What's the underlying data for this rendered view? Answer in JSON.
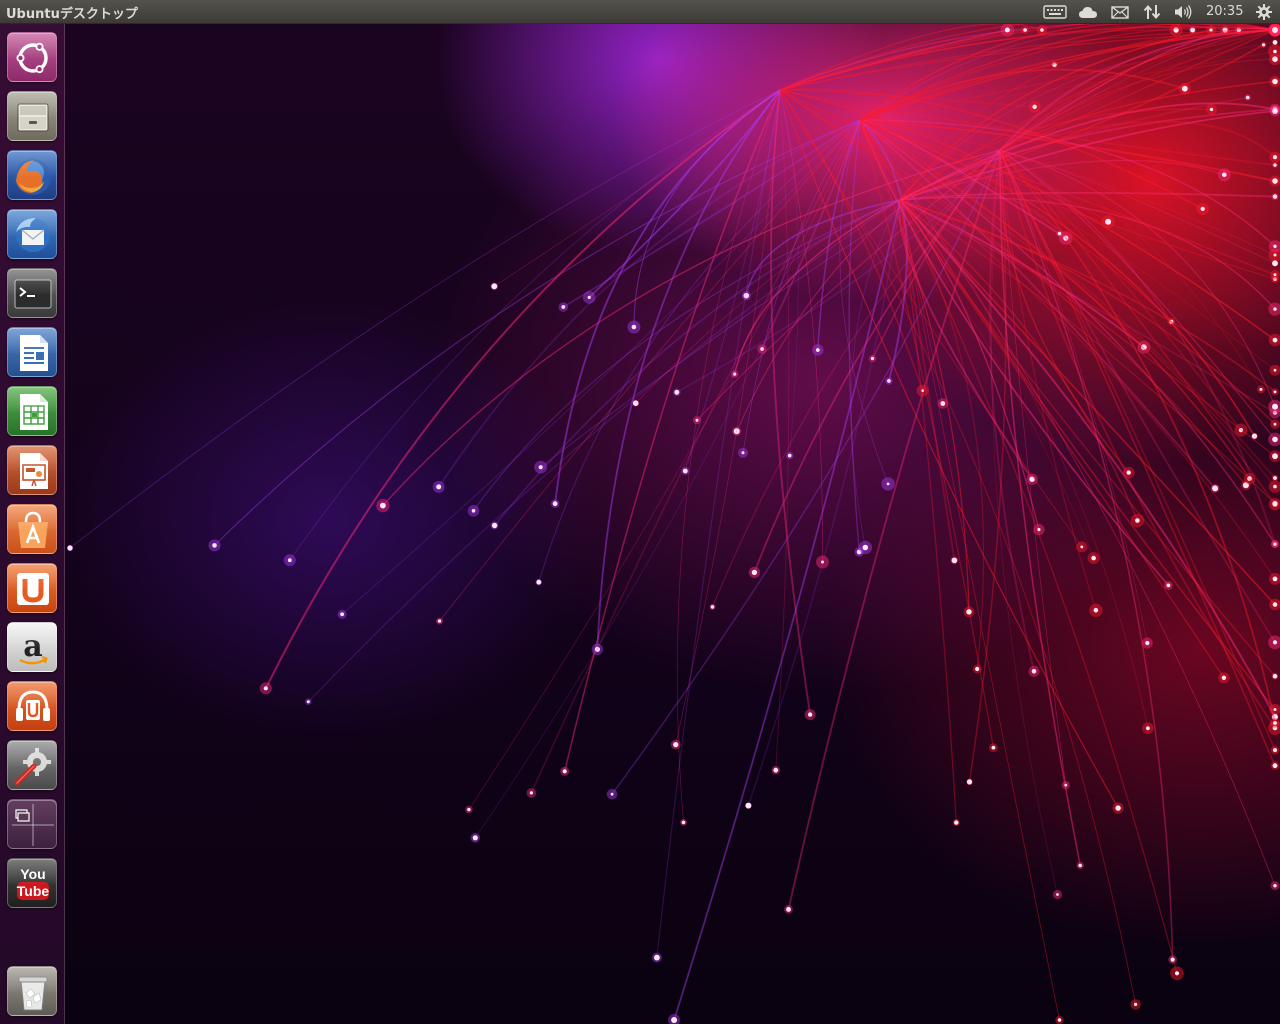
{
  "top_panel": {
    "title": "Ubuntuデスクトップ",
    "clock": "20:35",
    "indicators": [
      "keyboard-icon",
      "cloud-icon",
      "mail-icon",
      "network-icon",
      "volume-icon",
      "session-gear-icon"
    ]
  },
  "launcher": {
    "items": [
      {
        "name": "dash-home-icon",
        "color": "#a3387a"
      },
      {
        "name": "file-manager-icon",
        "color": "#8a8677"
      },
      {
        "name": "firefox-icon",
        "color": "#2b5fb4"
      },
      {
        "name": "thunderbird-icon",
        "color": "#2e6fb8"
      },
      {
        "name": "terminal-icon",
        "color": "#2b2b2b"
      },
      {
        "name": "libreoffice-writer-icon",
        "color": "#3b6fb5"
      },
      {
        "name": "libreoffice-calc-icon",
        "color": "#3c9d3a"
      },
      {
        "name": "libreoffice-impress-icon",
        "color": "#c4502a"
      },
      {
        "name": "software-center-icon",
        "color": "#e3672a"
      },
      {
        "name": "ubuntu-one-icon",
        "color": "#e65a20"
      },
      {
        "name": "amazon-icon",
        "color": "#d9d9d9"
      },
      {
        "name": "ubuntu-one-music-icon",
        "color": "#e2561f"
      },
      {
        "name": "system-settings-icon",
        "color": "#6a6a6a"
      },
      {
        "name": "workspace-switcher-icon",
        "color": "#5a3a55"
      },
      {
        "name": "youtube-icon",
        "color": "#b81d1d"
      },
      {
        "name": "trash-icon",
        "color": "#8d8a82"
      }
    ]
  },
  "youtube_icon": {
    "line1": "You",
    "line2": "Tube"
  },
  "amazon_icon": {
    "letter": "a"
  },
  "wallpaper": {
    "accent_colors": [
      "#ff2a7a",
      "#ff1a2a",
      "#a83cf0",
      "#4a2cff"
    ]
  }
}
